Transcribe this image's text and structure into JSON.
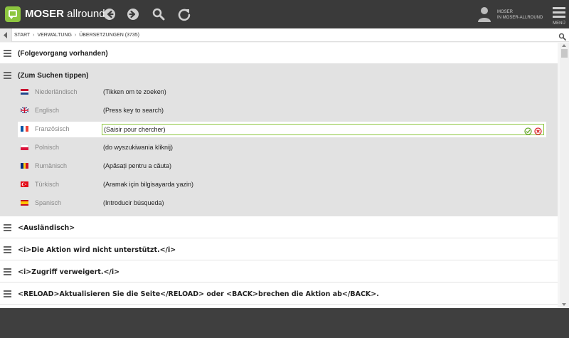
{
  "header": {
    "brand_bold": "MOSER",
    "brand_rest": " allround",
    "user_line1": "MOSER",
    "user_line2": "IN MOSER-ALLROUND",
    "menu_label": "MENÜ",
    "icons": [
      "back-icon",
      "forward-icon",
      "search-icon",
      "refresh-icon",
      "user-icon",
      "menu-icon"
    ]
  },
  "breadcrumb": {
    "items": [
      "START",
      "VERWALTUNG",
      "ÜBERSETZUNGEN (3735)"
    ],
    "separator": "›"
  },
  "rows": [
    {
      "title": "(Folgevorgang vorhanden)"
    },
    {
      "title": "(Zum Suchen tippen)"
    },
    {
      "title": "<Ausländisch>"
    },
    {
      "title": "<i>Die Aktion wird nicht unterstützt.</i>"
    },
    {
      "title": "<i>Zugriff verweigert.</i>"
    },
    {
      "title": "<RELOAD>Aktualisieren Sie die Seite</RELOAD> oder <BACK>brechen die Aktion ab</BACK>."
    }
  ],
  "translations": [
    {
      "language": "Niederländisch",
      "value": "(Tikken om te zoeken)",
      "flag": "nl"
    },
    {
      "language": "Englisch",
      "value": "(Press key to search)",
      "flag": "gb"
    },
    {
      "language": "Französisch",
      "value": "(Saisir pour chercher)",
      "flag": "fr",
      "editing": true
    },
    {
      "language": "Polnisch",
      "value": "(do wyszukiwania kliknij)",
      "flag": "pl"
    },
    {
      "language": "Rumänisch",
      "value": "(Apăsați pentru a căuta)",
      "flag": "ro"
    },
    {
      "language": "Türkisch",
      "value": "(Aramak için bilgisayarda yazin)",
      "flag": "tr"
    },
    {
      "language": "Spanisch",
      "value": "(Introducir búsqueda)",
      "flag": "es"
    }
  ],
  "colors": {
    "topbar": "#3a3a3a",
    "accent": "#8dc63f",
    "highlight_row": "#e2e2e2",
    "cancel": "#d9262c"
  }
}
